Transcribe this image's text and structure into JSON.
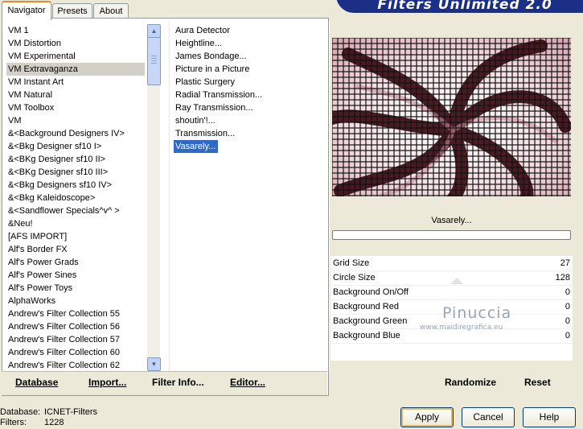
{
  "window": {
    "title": "Filters Unlimited 2.0"
  },
  "tabs": [
    {
      "label": "Navigator",
      "active": true
    },
    {
      "label": "Presets",
      "active": false
    },
    {
      "label": "About",
      "active": false
    }
  ],
  "categories": [
    "VM 1",
    "VM Distortion",
    "VM Experimental",
    "VM Extravaganza",
    "VM Instant Art",
    "VM Natural",
    "VM Toolbox",
    "VM",
    "&<Background Designers IV>",
    "&<Bkg Designer sf10 I>",
    "&<BKg Designer sf10 II>",
    "&<BKg Designer sf10 III>",
    "&<Bkg Designers sf10 IV>",
    "&<Bkg Kaleidoscope>",
    "&<Sandflower Specials^v^ >",
    "&Neu!",
    "[AFS IMPORT]",
    "Alf's Border FX",
    "Alf's Power Grads",
    "Alf's Power Sines",
    "Alf's Power Toys",
    "AlphaWorks",
    "Andrew's Filter Collection 55",
    "Andrew's Filter Collection 56",
    "Andrew's Filter Collection 57",
    "Andrew's Filter Collection 60",
    "Andrew's Filter Collection 62"
  ],
  "selected_category": "VM Extravaganza",
  "filters": [
    "Aura Detector",
    "Heightline...",
    "James Bondage...",
    "Picture in a Picture",
    "Plastic Surgery",
    "Radial Transmission...",
    "Ray Transmission...",
    "shoutin'!...",
    "Transmission...",
    "Vasarely..."
  ],
  "selected_filter": "Vasarely...",
  "left_buttons": {
    "database": "Database",
    "import": "Import...",
    "filter_info": "Filter Info...",
    "editor": "Editor..."
  },
  "current_filter_label": "Vasarely...",
  "params": [
    {
      "label": "Grid Size",
      "value": "27"
    },
    {
      "label": "Circle Size",
      "value": "128"
    },
    {
      "label": "Background On/Off",
      "value": "0"
    },
    {
      "label": "Background Red",
      "value": "0"
    },
    {
      "label": "Background Green",
      "value": "0"
    },
    {
      "label": "Background Blue",
      "value": "0"
    }
  ],
  "right_buttons": {
    "randomize": "Randomize",
    "reset": "Reset"
  },
  "watermark": {
    "name": "Pinuccia",
    "url": "www.maidiregrafica.eu"
  },
  "status": {
    "database_label": "Database:",
    "database_value": "ICNET-Filters",
    "filters_label": "Filters:",
    "filters_value": "1228"
  },
  "dialog_buttons": {
    "apply": "Apply",
    "cancel": "Cancel",
    "help": "Help"
  },
  "colors": {
    "accent": "#316ac5",
    "banner": "#1b2f86",
    "preview_dark": "#3a0a12",
    "preview_pink": "#d9a9b4"
  }
}
